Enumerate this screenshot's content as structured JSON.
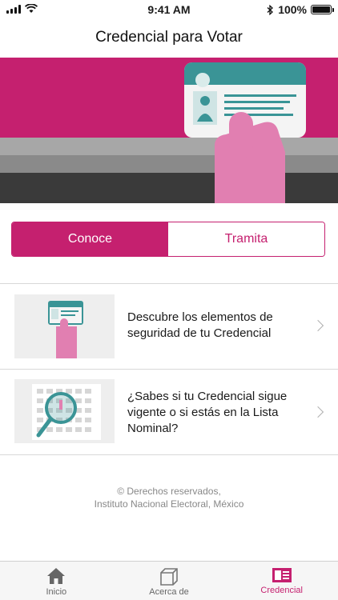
{
  "status_bar": {
    "time": "9:41 AM",
    "battery": "100%"
  },
  "nav": {
    "title": "Credencial para Votar"
  },
  "segment": {
    "options": [
      "Conoce",
      "Tramita"
    ],
    "selected": "Conoce"
  },
  "list": [
    {
      "text": "Descubre los elementos de seguridad de tu Credencial"
    },
    {
      "text": "¿Sabes si tu Credencial sigue vigente o si estás en la Lista Nominal?"
    }
  ],
  "footer": {
    "line1": "© Derechos reservados,",
    "line2": "Instituto Nacional Electoral, México"
  },
  "tabbar": {
    "tabs": [
      {
        "label": "Inicio",
        "icon": "home-icon"
      },
      {
        "label": "Acerca de",
        "icon": "box-icon"
      },
      {
        "label": "Credencial",
        "icon": "id-card-icon"
      }
    ],
    "selected": "Credencial"
  },
  "colors": {
    "accent": "#c5206f",
    "card_teal": "#3a9496",
    "hand_pink": "#e17fb1"
  }
}
